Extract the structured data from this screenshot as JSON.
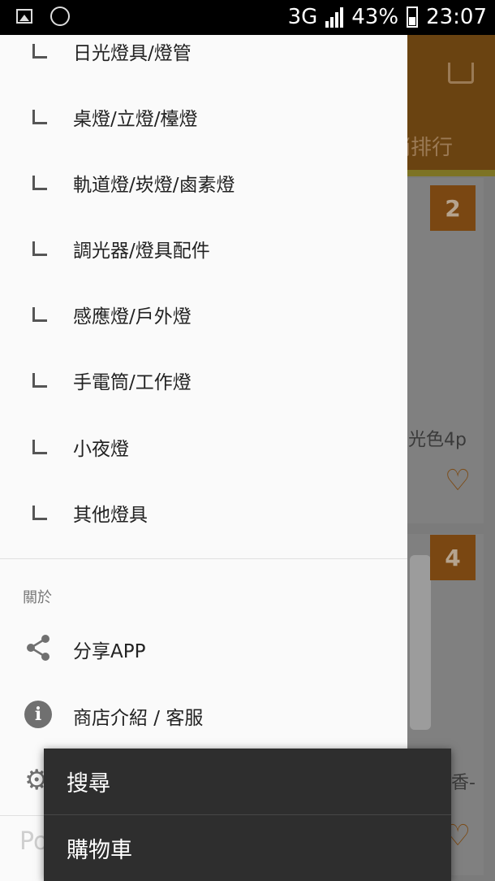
{
  "status_bar": {
    "network": "3G",
    "network_small": "3G",
    "battery": "43%",
    "time": "23:07"
  },
  "background": {
    "tab_partial": "銷排行",
    "rank_a": "2",
    "rank_b": "4",
    "product_text_a": "光色4p",
    "product_text_b": "香-",
    "accent_color": "#e8881f"
  },
  "drawer": {
    "categories": [
      "日光燈具/燈管",
      "桌燈/立燈/檯燈",
      "軌道燈/崁燈/鹵素燈",
      "調光器/燈具配件",
      "感應燈/戶外燈",
      "手電筒/工作燈",
      "小夜燈",
      "其他燈具"
    ],
    "about_section": "關於",
    "about_items": [
      {
        "icon": "share-icon",
        "label": "分享APP"
      },
      {
        "icon": "info-icon",
        "label": "商店介紹 / 客服"
      }
    ],
    "footer_partial": "Po"
  },
  "popup_menu": {
    "items": [
      "搜尋",
      "購物車"
    ]
  }
}
